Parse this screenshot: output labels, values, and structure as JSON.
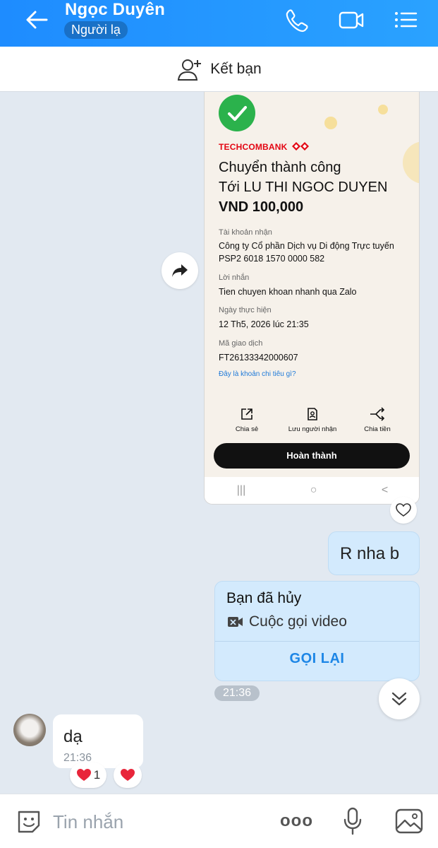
{
  "header": {
    "contact_name": "Ngọc Duyên",
    "tag": "Người lạ",
    "icons": [
      "back-arrow-icon",
      "phone-icon",
      "video-icon",
      "menu-icon"
    ]
  },
  "add_friend": {
    "label": "Kết bạn"
  },
  "receipt": {
    "bank": "TECHCOMBANK",
    "title_line1": "Chuyển thành công",
    "title_line2": "Tới LU THI NGOC DUYEN",
    "amount": "VND 100,000",
    "account_label": "Tài khoản nhận",
    "account_line1": "Công ty Cổ phần Dịch vụ Di động Trực tuyến",
    "account_line2": "PSP2 6018 1570 0000 582",
    "message_label": "Lời nhắn",
    "message_value": "Tien chuyen khoan nhanh qua Zalo",
    "date_label": "Ngày thực hiện",
    "date_value": "12 Th5, 2026 lúc 21:35",
    "txn_label": "Mã giao dịch",
    "txn_value": "FT26133342000607",
    "spend_link": "Đây là khoản chi tiêu gì?",
    "actions": [
      "Chia sẻ",
      "Lưu người nhận",
      "Chia tiền"
    ],
    "done_button": "Hoàn thành",
    "nav": [
      "|||",
      "○",
      "<"
    ]
  },
  "messages": {
    "me_text": "R nha b",
    "call_status": "Bạn đã hủy",
    "call_type": "Cuộc gọi video",
    "call_again": "GỌI LẠI",
    "call_time": "21:36",
    "other_text": "dạ",
    "other_time": "21:36",
    "reaction_count": "1"
  },
  "composer": {
    "placeholder": "Tin nhắn",
    "more_dots": "ooo"
  },
  "colors": {
    "header": "#1e8cff",
    "my_bubble": "#d3eafd",
    "accent": "#1d86e6",
    "bg": "#e2e9f1"
  }
}
